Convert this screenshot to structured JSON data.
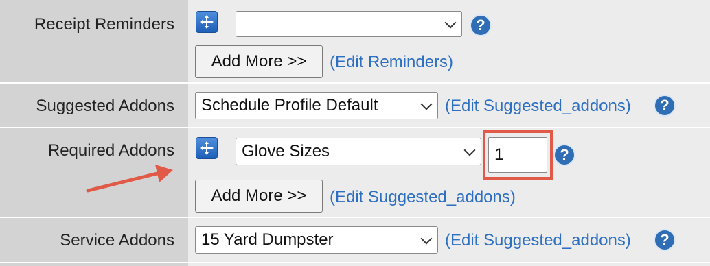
{
  "rows": {
    "receipt_reminders": {
      "label": "Receipt Reminders",
      "select_value": "",
      "add_more": "Add More >>",
      "edit_link": "(Edit Reminders)"
    },
    "suggested_addons": {
      "label": "Suggested Addons",
      "select_value": "Schedule Profile Default",
      "edit_link": "(Edit Suggested_addons)"
    },
    "required_addons": {
      "label": "Required Addons",
      "select_value": "Glove Sizes",
      "quantity": "1",
      "add_more": "Add More >>",
      "edit_link": "(Edit Suggested_addons)"
    },
    "service_addons": {
      "label": "Service Addons",
      "select_value": "15 Yard Dumpster",
      "edit_link": "(Edit Suggested_addons)"
    }
  },
  "help_glyph": "?",
  "colors": {
    "label_bg": "#d3d3d3",
    "value_bg": "#ececec",
    "link": "#2d6fc0",
    "help": "#2f6db5",
    "annotation": "#e05a47"
  },
  "icons": {
    "mover": "move-arrows-icon",
    "help": "help-icon",
    "chevron": "chevron-down-icon",
    "annotation_arrow": "annotation-arrow"
  }
}
